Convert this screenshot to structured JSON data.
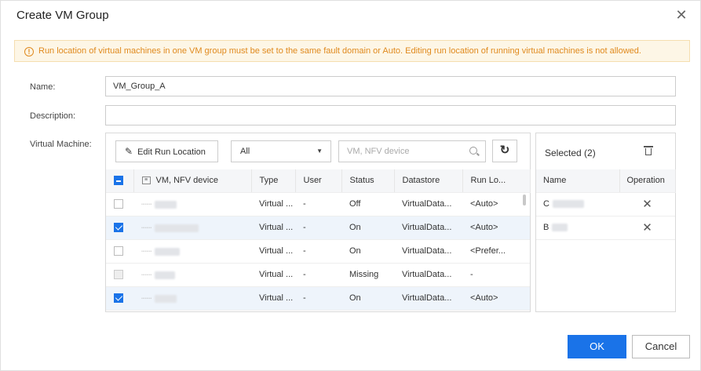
{
  "dialog": {
    "title": "Create VM Group",
    "close_icon": "close-icon"
  },
  "warning": {
    "icon": "info-icon",
    "text": "Run location of virtual machines in one VM group must be set to the same fault domain or Auto. Editing run location of running virtual machines is not allowed."
  },
  "form": {
    "name_label": "Name:",
    "name_value": "VM_Group_A",
    "description_label": "Description:",
    "description_value": "",
    "vm_label": "Virtual Machine:"
  },
  "toolbar": {
    "edit_run_location_label": "Edit Run Location",
    "filter_selected": "All",
    "search_placeholder": "VM, NFV device",
    "refresh_icon": "refresh-icon"
  },
  "vm_table": {
    "columns": [
      "VM, NFV device",
      "Type",
      "User",
      "Status",
      "Datastore",
      "Run Lo..."
    ],
    "rows": [
      {
        "checked": false,
        "disabled": false,
        "name": "",
        "type": "Virtual ...",
        "user": "-",
        "status": "Off",
        "datastore": "VirtualData...",
        "run_location": "<Auto>"
      },
      {
        "checked": true,
        "disabled": false,
        "name": "",
        "type": "Virtual ...",
        "user": "-",
        "status": "On",
        "datastore": "VirtualData...",
        "run_location": "<Auto>"
      },
      {
        "checked": false,
        "disabled": false,
        "name": "",
        "type": "Virtual ...",
        "user": "-",
        "status": "On",
        "datastore": "VirtualData...",
        "run_location": "<Prefer..."
      },
      {
        "checked": false,
        "disabled": true,
        "name": "",
        "type": "Virtual ...",
        "user": "-",
        "status": "Missing",
        "datastore": "VirtualData...",
        "run_location": "-"
      },
      {
        "checked": true,
        "disabled": false,
        "name": "",
        "type": "Virtual ...",
        "user": "-",
        "status": "On",
        "datastore": "VirtualData...",
        "run_location": "<Auto>"
      }
    ]
  },
  "selected_panel": {
    "title": "Selected (2)",
    "columns": [
      "Name",
      "Operation"
    ],
    "rows": [
      {
        "name": "C",
        "remove_icon": "close-icon"
      },
      {
        "name": "B",
        "remove_icon": "close-icon"
      }
    ]
  },
  "footer": {
    "ok_label": "OK",
    "cancel_label": "Cancel"
  },
  "colors": {
    "primary": "#1a73e8",
    "warning_text": "#e08a1e",
    "warning_bg": "#fdf6e6"
  }
}
